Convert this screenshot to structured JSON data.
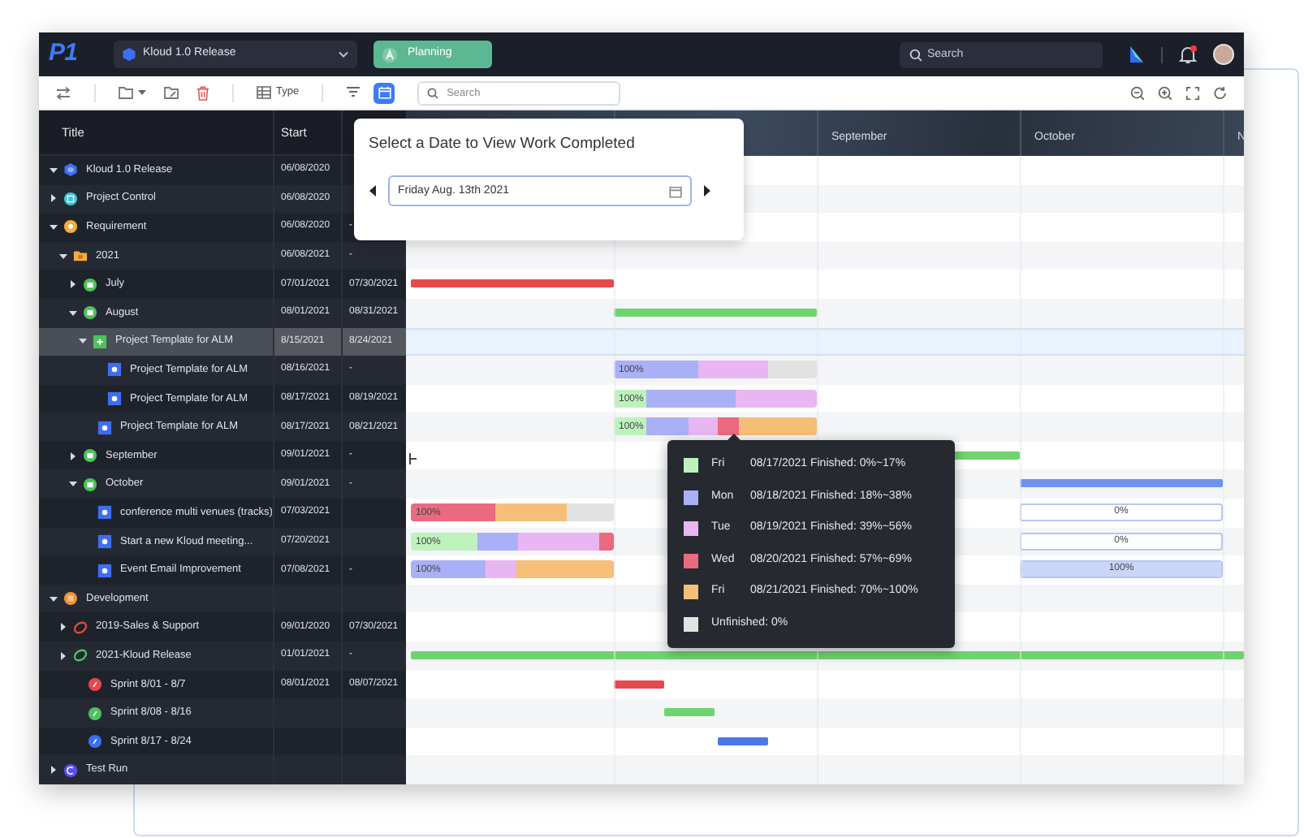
{
  "nav": {
    "logo": "P1",
    "project": "Kloud 1.0 Release",
    "mode_button": "Planning",
    "search": {
      "placeholder": "Search"
    },
    "notifications": {
      "unread": true
    }
  },
  "toolbar": {
    "type_button": "Type",
    "calendar_active": true,
    "search": {
      "placeholder": "Search"
    }
  },
  "table": {
    "columns": [
      {
        "label": "Title"
      },
      {
        "label": "Start"
      }
    ],
    "rows": [
      {
        "title": "Kloud 1.0 Release",
        "kind": "release",
        "expanded": true,
        "selected": false,
        "start": "06/08/2020"
      },
      {
        "title": "Project Control",
        "kind": "project",
        "expanded": false,
        "selected": false,
        "start": "06/08/2020"
      },
      {
        "title": "Requirement",
        "kind": "requirement",
        "expanded": true,
        "selected": false,
        "start": "06/08/2020",
        "end": "-",
        "children": [
          {
            "title": "2021",
            "kind": "folder",
            "expanded": true,
            "selected": false,
            "start": "06/08/2021",
            "end": "-",
            "children": [
              {
                "title": "July",
                "kind": "month",
                "expanded": false,
                "selected": false,
                "start": "07/01/2021",
                "end": "07/30/2021",
                "timeline": [
                  {
                    "kind": "line",
                    "color": "#e5484d"
                  }
                ]
              },
              {
                "title": "August",
                "kind": "month",
                "expanded": true,
                "selected": false,
                "start": "08/01/2021",
                "end": "08/31/2021",
                "timeline": [
                  {
                    "kind": "line",
                    "color": "#6fd36f"
                  }
                ],
                "children": [
                  {
                    "title": "Project Template for ALM",
                    "kind": "task",
                    "expanded": true,
                    "selected": true,
                    "start": "8/15/2021",
                    "end": "8/24/2021",
                    "children": [
                      {
                        "title": "Project Template for ALM",
                        "kind": "subtask",
                        "selected": false,
                        "start": "08/16/2021",
                        "end": "-",
                        "timeline": [
                          {
                            "kind": "segmented",
                            "label": "100%",
                            "segments": [
                              {
                                "color": "#aab0f5"
                              },
                              {
                                "color": "#e8b6f2"
                              },
                              {
                                "color": "#e2e2e2"
                              }
                            ]
                          }
                        ]
                      },
                      {
                        "title": "Project Template for ALM",
                        "kind": "subtask",
                        "selected": false,
                        "start": "08/17/2021",
                        "end": "08/19/2021",
                        "timeline": [
                          {
                            "kind": "segmented",
                            "label": "100%",
                            "segments": [
                              {
                                "color": "#bdf2bd"
                              },
                              {
                                "color": "#aab0f5"
                              },
                              {
                                "color": "#e8b6f2"
                              }
                            ]
                          }
                        ]
                      }
                    ]
                  },
                  {
                    "title": "Project Template for ALM",
                    "kind": "subtask",
                    "selected": false,
                    "start": "08/17/2021",
                    "end": "08/21/2021",
                    "timeline": [
                      {
                        "kind": "segmented",
                        "label": "100%",
                        "segments": [
                          {
                            "color": "#bdf2bd"
                          },
                          {
                            "color": "#aab0f5"
                          },
                          {
                            "color": "#e8b6f2"
                          },
                          {
                            "color": "#ea6a80"
                          },
                          {
                            "color": "#f5bf78"
                          }
                        ]
                      }
                    ]
                  }
                ]
              },
              {
                "title": "September",
                "kind": "month",
                "expanded": false,
                "selected": false,
                "start": "09/01/2021",
                "end": "-",
                "timeline": [
                  {
                    "kind": "line",
                    "color": "#6fd36f"
                  }
                ]
              },
              {
                "title": "October",
                "kind": "month",
                "expanded": true,
                "selected": false,
                "start": "09/01/2021",
                "end": "-",
                "timeline": [
                  {
                    "kind": "line",
                    "color": "#6f92ef"
                  }
                ],
                "children": [
                  {
                    "title": "conference multi venues (tracks)",
                    "kind": "subtask",
                    "selected": false,
                    "start": "07/03/2021",
                    "timeline": [
                      {
                        "kind": "segmented",
                        "label": "100%",
                        "segments": [
                          {
                            "color": "#ea6a80"
                          },
                          {
                            "color": "#f5bf78"
                          },
                          {
                            "color": "#e2e2e2"
                          }
                        ]
                      },
                      {
                        "kind": "progress",
                        "label": "0%",
                        "level": 0
                      }
                    ]
                  },
                  {
                    "title": "Start a new Kloud meeting...",
                    "kind": "subtask",
                    "selected": false,
                    "start": "07/20/2021",
                    "timeline": [
                      {
                        "kind": "segmented",
                        "label": "100%",
                        "segments": [
                          {
                            "color": "#bdf2bd"
                          },
                          {
                            "color": "#aab0f5"
                          },
                          {
                            "color": "#e8b6f2"
                          },
                          {
                            "color": "#ea6a80"
                          }
                        ]
                      },
                      {
                        "kind": "progress",
                        "label": "0%",
                        "level": 0
                      }
                    ]
                  },
                  {
                    "title": "Event Email Improvement",
                    "kind": "subtask",
                    "selected": false,
                    "start": "07/08/2021",
                    "end": "-",
                    "timeline": [
                      {
                        "kind": "segmented",
                        "label": "100%",
                        "segments": [
                          {
                            "color": "#aab0f5"
                          },
                          {
                            "color": "#e8b6f2"
                          },
                          {
                            "color": "#f5bf78"
                          }
                        ]
                      },
                      {
                        "kind": "progress",
                        "label": "100%",
                        "level": 1
                      }
                    ]
                  }
                ]
              }
            ]
          }
        ]
      },
      {
        "title": "Development",
        "kind": "development",
        "expanded": true,
        "selected": false,
        "children": [
          {
            "title": "2019-Sales & Support",
            "kind": "ring",
            "color": "#e04a3a",
            "expanded": false,
            "selected": false,
            "start": "09/01/2020",
            "end": "07/30/2021"
          },
          {
            "title": "2021-Kloud Release",
            "kind": "ring",
            "color": "#4cc35a",
            "expanded": false,
            "selected": false,
            "start": "01/01/2021",
            "end": "-",
            "timeline": [
              {
                "kind": "line",
                "color": "#6fd36f"
              }
            ],
            "children": [
              {
                "title": "Sprint 8/01 - 8/7",
                "kind": "sprint",
                "color": "#e5484d",
                "selected": false,
                "start": "08/01/2021",
                "end": "08/07/2021",
                "timeline": [
                  {
                    "kind": "line",
                    "color": "#e5484d"
                  }
                ]
              },
              {
                "title": "Sprint 8/08 - 8/16",
                "kind": "sprint",
                "color": "#4cc35a",
                "selected": false,
                "timeline": [
                  {
                    "kind": "line",
                    "color": "#6fd36f"
                  }
                ]
              },
              {
                "title": "Sprint 8/17 - 8/24",
                "kind": "sprint",
                "color": "#3b6ef5",
                "selected": false,
                "timeline": [
                  {
                    "kind": "line",
                    "color": "#4a78e8"
                  }
                ]
              }
            ]
          }
        ]
      },
      {
        "title": "Test Run",
        "kind": "test",
        "expanded": false,
        "selected": false
      }
    ]
  },
  "timeline": {
    "months": [
      {
        "label": "September"
      },
      {
        "label": "October"
      },
      {
        "label": "N"
      }
    ]
  },
  "date_popup": {
    "title": "Select a Date to View Work Completed",
    "date": "Friday Aug. 13th 2021"
  },
  "legend_tooltip": {
    "items": [
      {
        "color": "#bdf2bd",
        "day": "Fri",
        "text": "08/17/2021 Finished: 0%~17%"
      },
      {
        "color": "#aab0f5",
        "day": "Mon",
        "text": "08/18/2021 Finished: 18%~38%"
      },
      {
        "color": "#e8b6f2",
        "day": "Tue",
        "text": "08/19/2021 Finished: 39%~56%"
      },
      {
        "color": "#ea6a80",
        "day": "Wed",
        "text": "08/20/2021 Finished: 57%~69%"
      },
      {
        "color": "#f5bf78",
        "day": "Fri",
        "text": "08/21/2021 Finished: 70%~100%"
      },
      {
        "color": "#e3e3e3",
        "text": "Unfinished: 0%"
      }
    ]
  }
}
